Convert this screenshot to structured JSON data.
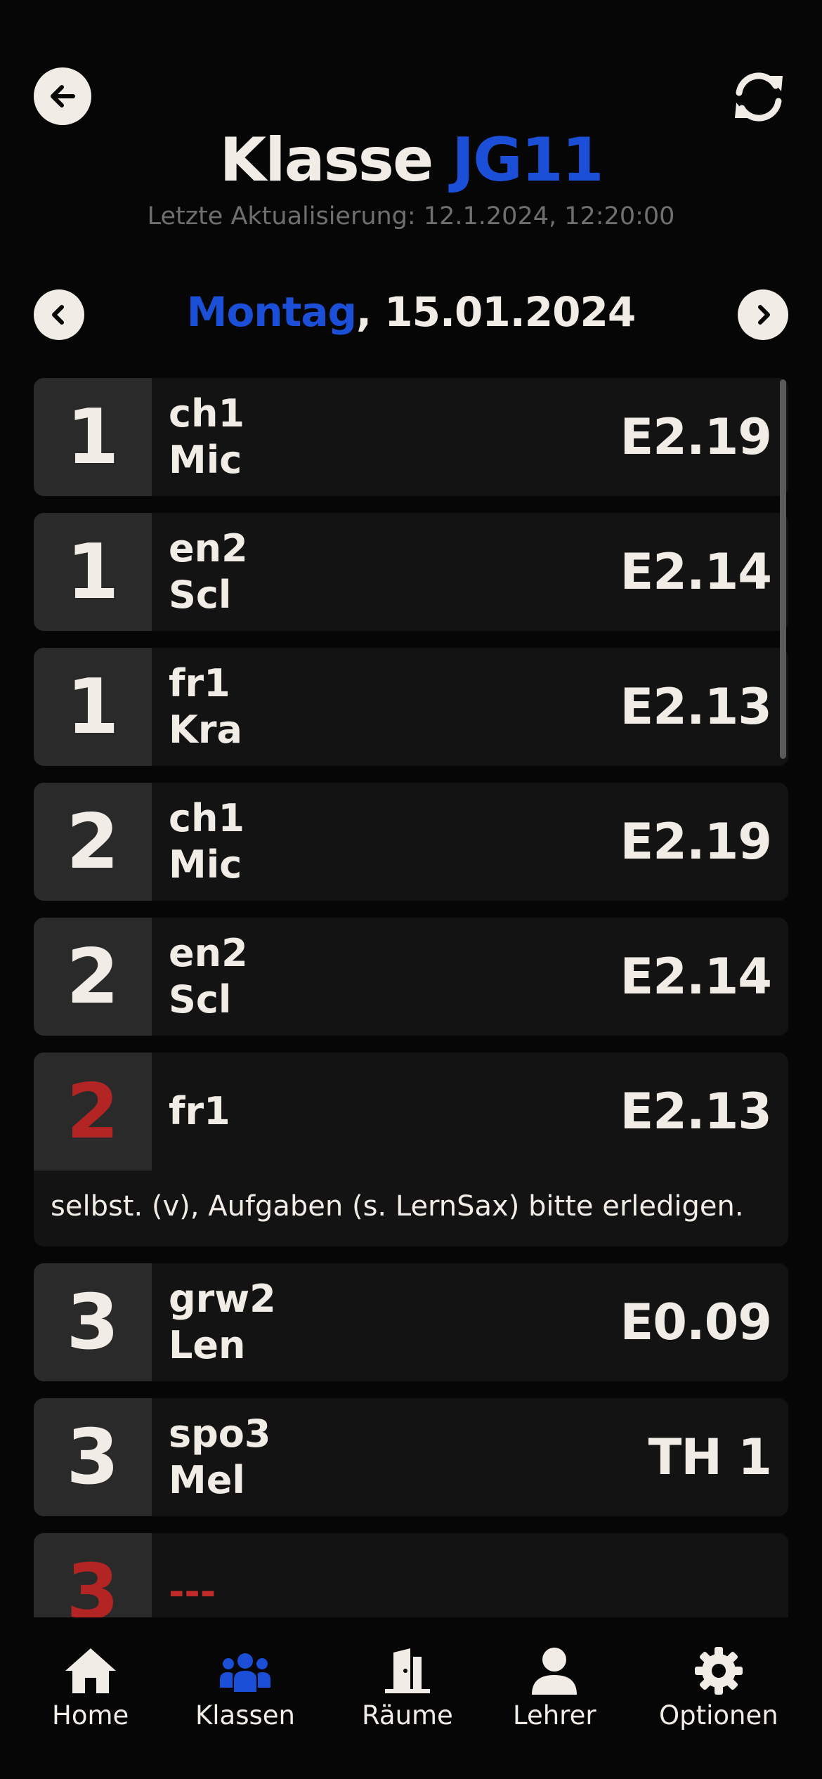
{
  "header": {
    "title_prefix": "Klasse ",
    "title_class": "JG11",
    "last_update": "Letzte Aktualisierung: 12.1.2024, 12:20:00"
  },
  "date_nav": {
    "weekday": "Montag",
    "date": ", 15.01.2024"
  },
  "lessons": [
    {
      "period": "1",
      "subject": "ch1",
      "teacher": "Mic",
      "room": "E2.19"
    },
    {
      "period": "1",
      "subject": "en2",
      "teacher": "Scl",
      "room": "E2.14"
    },
    {
      "period": "1",
      "subject": "fr1",
      "teacher": "Kra",
      "room": "E2.13"
    },
    {
      "period": "2",
      "subject": "ch1",
      "teacher": "Mic",
      "room": "E2.19"
    },
    {
      "period": "2",
      "subject": "en2",
      "teacher": "Scl",
      "room": "E2.14"
    },
    {
      "period": "2",
      "subject": "fr1",
      "room": "E2.13",
      "note": "selbst. (v), Aufgaben (s. LernSax) bitte erledigen."
    },
    {
      "period": "3",
      "subject": "grw2",
      "teacher": "Len",
      "room": "E0.09"
    },
    {
      "period": "3",
      "subject": "spo3",
      "teacher": "Mel",
      "room": "TH 1"
    },
    {
      "period": "3",
      "subject": "---"
    }
  ],
  "nav": {
    "home": "Home",
    "classes": "Klassen",
    "rooms": "Räume",
    "teachers": "Lehrer",
    "options": "Optionen"
  },
  "colors": {
    "accent": "#1c4fd8",
    "cancelled": "#b32525",
    "text": "#f1ece6",
    "background": "#060606"
  },
  "icons": [
    "arrow-left-icon",
    "refresh-icon",
    "chevron-left-icon",
    "chevron-right-icon",
    "home-icon",
    "users-icon",
    "door-icon",
    "user-icon",
    "gear-icon"
  ]
}
